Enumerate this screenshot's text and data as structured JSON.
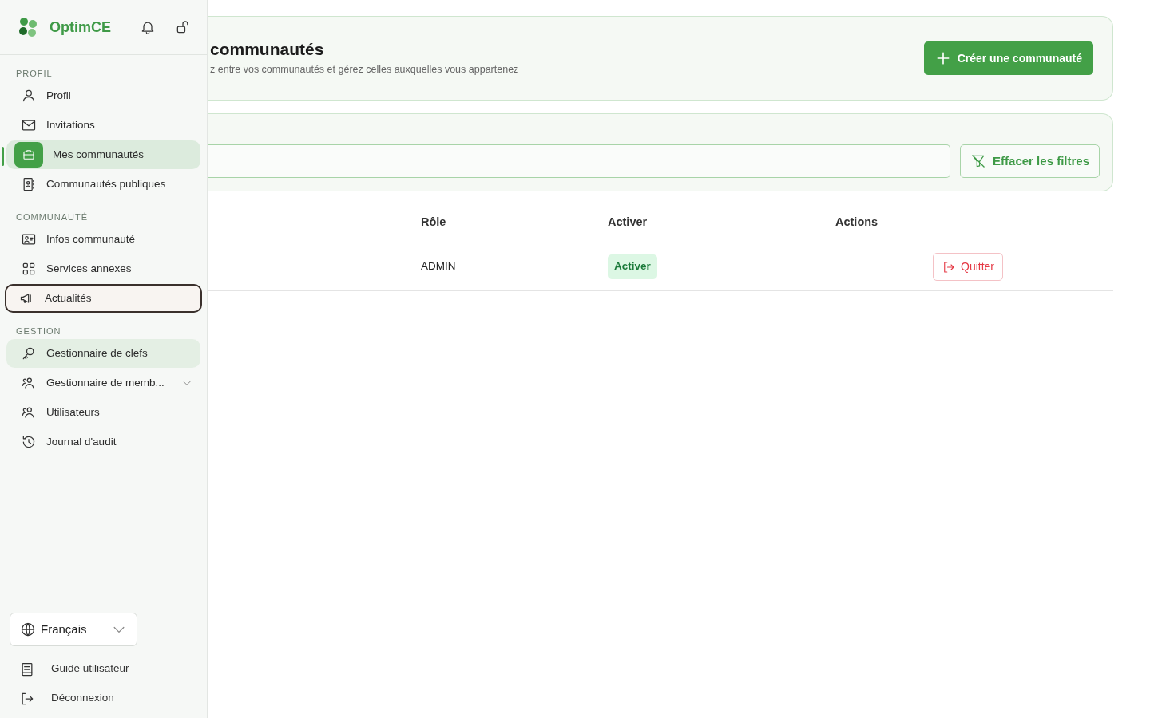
{
  "brand": {
    "name": "OptimCE"
  },
  "sidebar": {
    "sections": [
      {
        "title": "PROFIL",
        "items": [
          {
            "label": "Profil",
            "kind": "person",
            "selected": false,
            "focused": false,
            "hovered": false
          },
          {
            "label": "Invitations",
            "kind": "mail",
            "selected": false,
            "focused": false,
            "hovered": false
          },
          {
            "label": "Mes communautés",
            "kind": "briefcase",
            "selected": true,
            "focused": false,
            "hovered": false
          },
          {
            "label": "Communautés publiques",
            "kind": "contact",
            "selected": false,
            "focused": false,
            "hovered": false
          }
        ]
      },
      {
        "title": "COMMUNAUTÉ",
        "items": [
          {
            "label": "Infos communauté",
            "kind": "idcard",
            "selected": false,
            "focused": false,
            "hovered": false
          },
          {
            "label": "Services annexes",
            "kind": "grid",
            "selected": false,
            "focused": false,
            "hovered": false
          },
          {
            "label": "Actualités",
            "kind": "megaphone",
            "selected": false,
            "focused": true,
            "hovered": false
          }
        ]
      },
      {
        "title": "GESTION",
        "items": [
          {
            "label": "Gestionnaire de clefs",
            "kind": "key",
            "selected": false,
            "focused": false,
            "hovered": true
          },
          {
            "label": "Gestionnaire de memb...",
            "kind": "people",
            "selected": false,
            "focused": false,
            "hovered": false,
            "expanded": false
          },
          {
            "label": "Utilisateurs",
            "kind": "people",
            "selected": false,
            "focused": false,
            "hovered": false
          },
          {
            "label": "Journal d'audit",
            "kind": "history",
            "selected": false,
            "focused": false,
            "hovered": false
          }
        ]
      }
    ],
    "language": {
      "value": "Français"
    },
    "footer_links": [
      {
        "label": "Guide utilisateur",
        "kind": "book"
      },
      {
        "label": "Déconnexion",
        "kind": "logout"
      }
    ]
  },
  "header": {
    "title": "communautés",
    "subtitle": "z entre vos communautés et gérez celles auxquelles vous appartenez",
    "create_button": "Créer une communauté"
  },
  "filters": {
    "clear_button": "Effacer les filtres"
  },
  "table": {
    "columns": [
      "",
      "Rôle",
      "Activer",
      "Actions"
    ],
    "rows": [
      {
        "role": "ADMIN",
        "status": "Activer",
        "action": "Quitter"
      }
    ]
  }
}
